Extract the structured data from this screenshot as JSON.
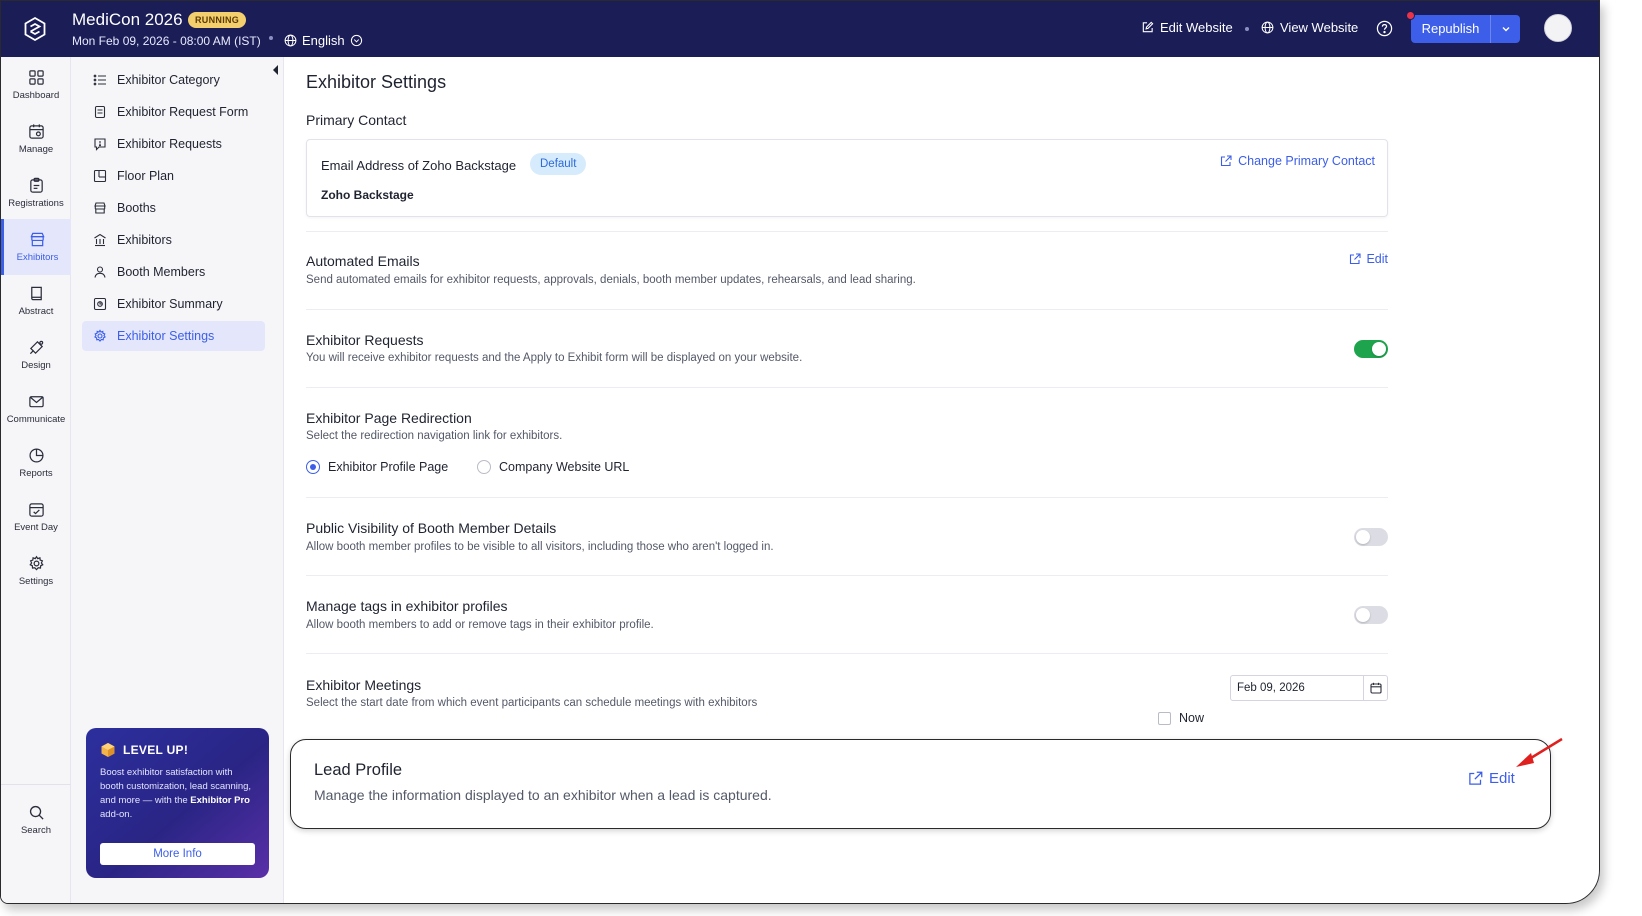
{
  "header": {
    "app_title": "MediCon 2026",
    "status": "RUNNING",
    "event_date": "Mon Feb 09, 2026 - 08:00 AM (IST)",
    "language": "English",
    "edit_website": "Edit Website",
    "view_website": "View Website",
    "republish": "Republish"
  },
  "rail": {
    "items": [
      {
        "label": "Dashboard",
        "icon": "grid-icon"
      },
      {
        "label": "Manage",
        "icon": "calendar-gear-icon"
      },
      {
        "label": "Registrations",
        "icon": "clipboard-icon"
      },
      {
        "label": "Exhibitors",
        "icon": "booth-icon"
      },
      {
        "label": "Abstract",
        "icon": "book-icon"
      },
      {
        "label": "Design",
        "icon": "pen-tool-icon"
      },
      {
        "label": "Communicate",
        "icon": "mail-icon"
      },
      {
        "label": "Reports",
        "icon": "pie-chart-icon"
      },
      {
        "label": "Event Day",
        "icon": "calendar-check-icon"
      },
      {
        "label": "Settings",
        "icon": "gear-icon"
      }
    ],
    "search": "Search"
  },
  "subnav": {
    "items": [
      {
        "label": "Exhibitor Category"
      },
      {
        "label": "Exhibitor Request Form"
      },
      {
        "label": "Exhibitor Requests"
      },
      {
        "label": "Floor Plan"
      },
      {
        "label": "Booths"
      },
      {
        "label": "Exhibitors"
      },
      {
        "label": "Booth Members"
      },
      {
        "label": "Exhibitor Summary"
      },
      {
        "label": "Exhibitor Settings"
      }
    ]
  },
  "promo": {
    "title": "LEVEL UP!",
    "body_prefix": "Boost exhibitor satisfaction with booth customization, lead scanning, and more — with the ",
    "body_bold": "Exhibitor Pro",
    "body_suffix": " add-on.",
    "button": "More Info"
  },
  "main": {
    "title": "Exhibitor Settings",
    "primary_contact": {
      "heading": "Primary Contact",
      "email_label": "Email Address of Zoho Backstage",
      "badge": "Default",
      "name": "Zoho Backstage",
      "change_link": "Change Primary Contact"
    },
    "automated_emails": {
      "title": "Automated Emails",
      "desc": "Send automated emails for exhibitor requests, approvals, denials, booth member updates, rehearsals, and lead sharing.",
      "edit": "Edit"
    },
    "exhibitor_requests": {
      "title": "Exhibitor Requests",
      "desc": "You will receive exhibitor requests and the Apply to Exhibit form will be displayed on your website.",
      "enabled": true
    },
    "redirection": {
      "title": "Exhibitor Page Redirection",
      "desc": "Select the redirection navigation link for exhibitors.",
      "options": [
        "Exhibitor Profile Page",
        "Company Website URL"
      ],
      "selected": "Exhibitor Profile Page"
    },
    "public_visibility": {
      "title": "Public Visibility of Booth Member Details",
      "desc": "Allow booth member profiles to be visible to all visitors, including those who aren't logged in.",
      "enabled": false
    },
    "manage_tags": {
      "title": "Manage tags in exhibitor profiles",
      "desc": "Allow booth members to add or remove tags in their exhibitor profile.",
      "enabled": false
    },
    "meetings": {
      "title": "Exhibitor Meetings",
      "desc": "Select the start date from which event participants can schedule meetings with exhibitors",
      "date": "Feb 09, 2026",
      "now_label": "Now",
      "now_checked": false
    },
    "lead_profile": {
      "title": "Lead Profile",
      "desc": "Manage the information displayed to an exhibitor when a lead is captured.",
      "edit": "Edit"
    }
  },
  "colors": {
    "header_bg": "#1b1d57",
    "accent": "#3c5ee8",
    "toggle_on": "#1ea44d",
    "annotation_arrow": "#e0201f"
  }
}
